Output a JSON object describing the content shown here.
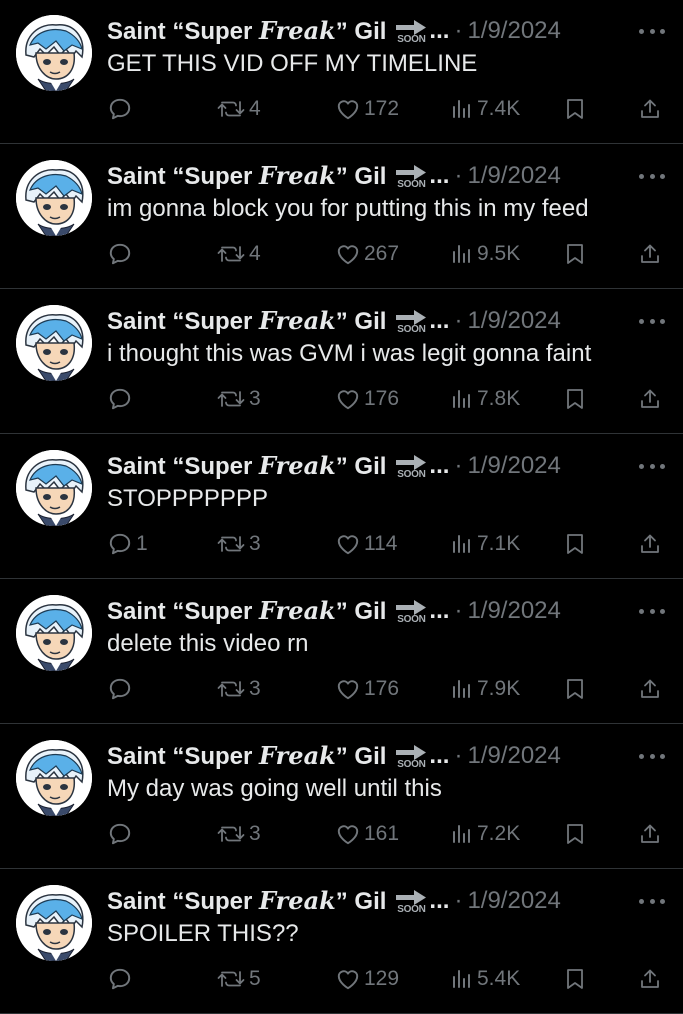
{
  "colors": {
    "background": "#000000",
    "text_primary": "#e7e9ea",
    "text_secondary": "#71767b",
    "divider": "#2f3336"
  },
  "author": {
    "name_prefix": "Saint “Super ",
    "name_styled": "Freak",
    "name_suffix": "” Gil",
    "badge_text": "SOON",
    "badge_icon": "right-arrow-icon",
    "ellipsis": "...",
    "separator": "·"
  },
  "tweets": [
    {
      "date": "1/9/2024",
      "text": "GET THIS VID OFF MY TIMELINE",
      "replies": "",
      "retweets": "4",
      "likes": "172",
      "views": "7.4K"
    },
    {
      "date": "1/9/2024",
      "text": "im gonna block you for putting this in my feed",
      "replies": "",
      "retweets": "4",
      "likes": "267",
      "views": "9.5K"
    },
    {
      "date": "1/9/2024",
      "text": "i thought this was GVM i was legit gonna faint",
      "replies": "",
      "retweets": "3",
      "likes": "176",
      "views": "7.8K"
    },
    {
      "date": "1/9/2024",
      "text": "STOPPPPPPP",
      "replies": "1",
      "retweets": "3",
      "likes": "114",
      "views": "7.1K"
    },
    {
      "date": "1/9/2024",
      "text": "delete this video rn",
      "replies": "",
      "retweets": "3",
      "likes": "176",
      "views": "7.9K"
    },
    {
      "date": "1/9/2024",
      "text": "My day was going well until this",
      "replies": "",
      "retweets": "3",
      "likes": "161",
      "views": "7.2K"
    },
    {
      "date": "1/9/2024",
      "text": "SPOILER THIS??",
      "replies": "",
      "retweets": "5",
      "likes": "129",
      "views": "5.4K"
    }
  ],
  "icons": {
    "avatar": "anime-avatar",
    "more": "more-options-icon",
    "reply": "reply-icon",
    "retweet": "retweet-icon",
    "like": "heart-icon",
    "views": "views-bar-chart-icon",
    "bookmark": "bookmark-icon",
    "share": "share-icon"
  }
}
